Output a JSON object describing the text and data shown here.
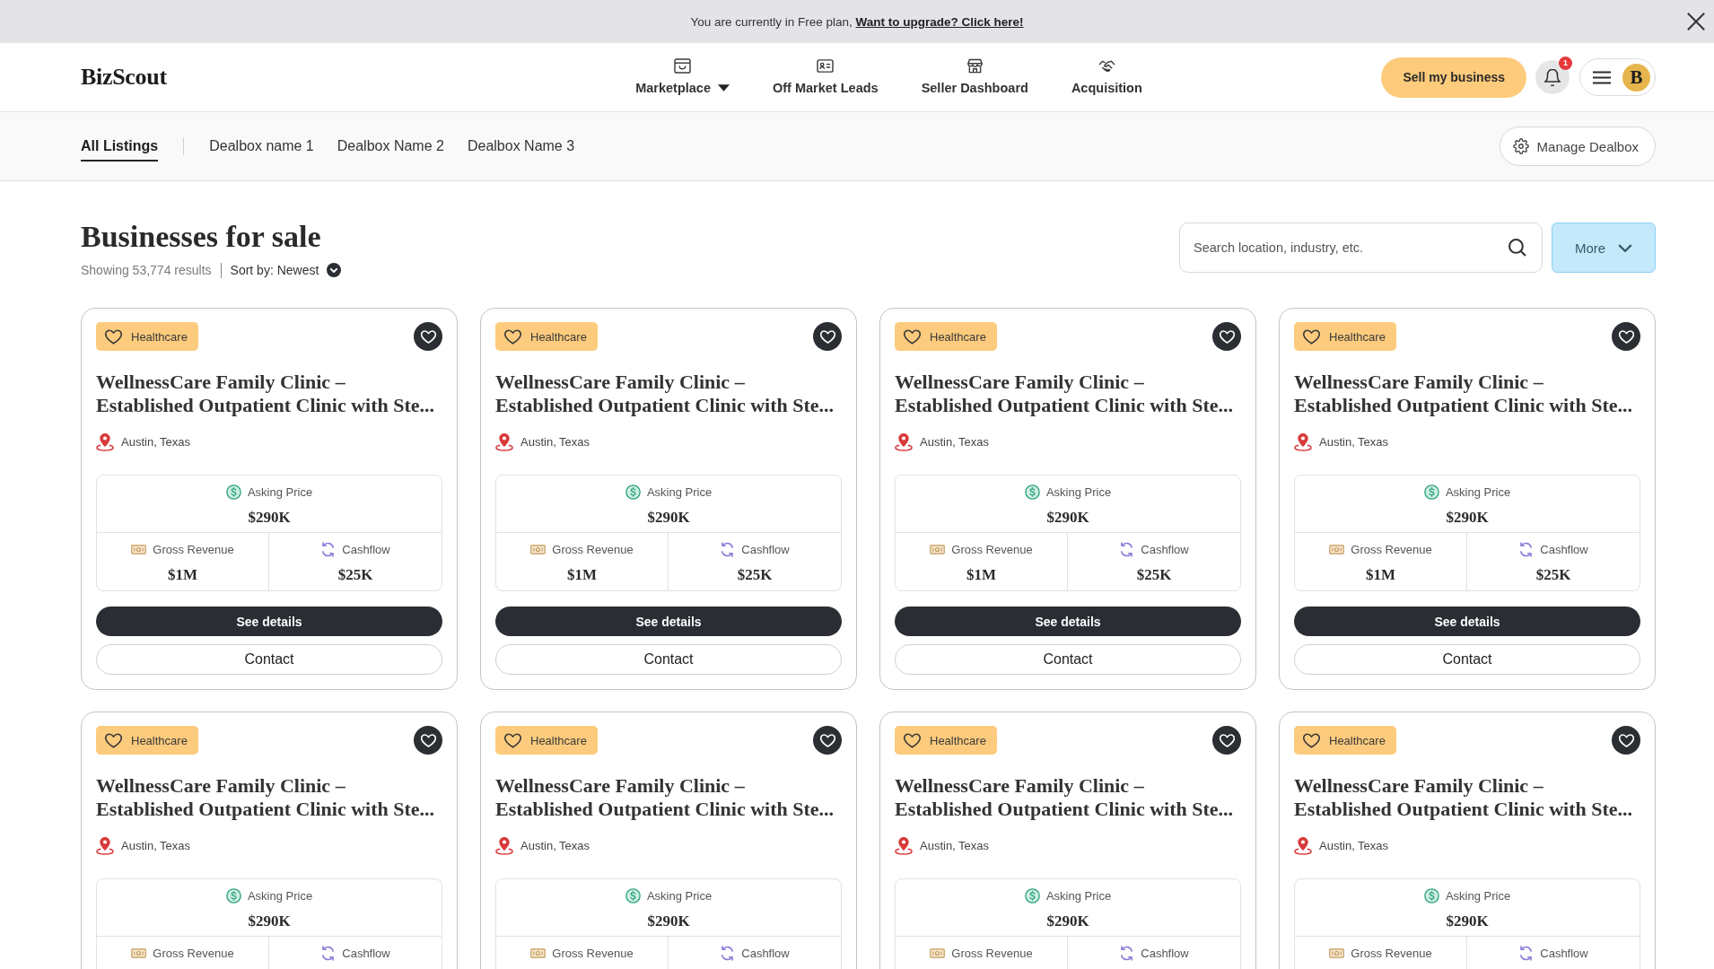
{
  "banner": {
    "text": "You are currently in Free plan,",
    "link": "Want to upgrade? Click here!"
  },
  "header": {
    "logo": "BizScout",
    "nav": [
      {
        "label": "Marketplace",
        "kind": "dropdown"
      },
      {
        "label": "Off Market Leads",
        "kind": "link"
      },
      {
        "label": "Seller Dashboard",
        "kind": "link"
      },
      {
        "label": "Acquisition",
        "kind": "link"
      }
    ],
    "sell_button": "Sell my business",
    "notifications": "1",
    "avatar": "B"
  },
  "subnav": {
    "tabs": [
      {
        "label": "All Listings",
        "selected": true
      },
      {
        "label": "Dealbox name 1",
        "selected": false
      },
      {
        "label": "Dealbox Name 2",
        "selected": false
      },
      {
        "label": "Dealbox Name 3",
        "selected": false
      }
    ],
    "manage_button": "Manage Dealbox"
  },
  "listings": {
    "title": "Businesses for sale",
    "results": "Showing 53,774 results",
    "sort": "Sort by: Newest",
    "search": {
      "placeholder": "Search location, industry, etc."
    },
    "more_button": "More",
    "cards": [
      {
        "category": "Healthcare",
        "title": "WellnessCare Family Clinic – Established Outpatient Clinic with Ste...",
        "location": "Austin, Texas",
        "stats": [
          {
            "label": "Asking Price",
            "value": "$290K"
          },
          {
            "label": "Gross Revenue",
            "value": "$1M"
          },
          {
            "label": "Cashflow",
            "value": "$25K"
          }
        ],
        "actions": [
          {
            "label": "See details",
            "kind": "primary"
          },
          {
            "label": "Contact",
            "kind": "secondary"
          }
        ]
      },
      {
        "category": "Healthcare",
        "title": "WellnessCare Family Clinic – Established Outpatient Clinic with Ste...",
        "location": "Austin, Texas",
        "stats": [
          {
            "label": "Asking Price",
            "value": "$290K"
          },
          {
            "label": "Gross Revenue",
            "value": "$1M"
          },
          {
            "label": "Cashflow",
            "value": "$25K"
          }
        ],
        "actions": [
          {
            "label": "See details",
            "kind": "primary"
          },
          {
            "label": "Contact",
            "kind": "secondary"
          }
        ]
      },
      {
        "category": "Healthcare",
        "title": "WellnessCare Family Clinic – Established Outpatient Clinic with Ste...",
        "location": "Austin, Texas",
        "stats": [
          {
            "label": "Asking Price",
            "value": "$290K"
          },
          {
            "label": "Gross Revenue",
            "value": "$1M"
          },
          {
            "label": "Cashflow",
            "value": "$25K"
          }
        ],
        "actions": [
          {
            "label": "See details",
            "kind": "primary"
          },
          {
            "label": "Contact",
            "kind": "secondary"
          }
        ]
      },
      {
        "category": "Healthcare",
        "title": "WellnessCare Family Clinic – Established Outpatient Clinic with Ste...",
        "location": "Austin, Texas",
        "stats": [
          {
            "label": "Asking Price",
            "value": "$290K"
          },
          {
            "label": "Gross Revenue",
            "value": "$1M"
          },
          {
            "label": "Cashflow",
            "value": "$25K"
          }
        ],
        "actions": [
          {
            "label": "See details",
            "kind": "primary"
          },
          {
            "label": "Contact",
            "kind": "secondary"
          }
        ]
      },
      {
        "category": "Healthcare",
        "title": "WellnessCare Family Clinic – Established Outpatient Clinic with Ste...",
        "location": "Austin, Texas",
        "stats": [
          {
            "label": "Asking Price",
            "value": "$290K"
          },
          {
            "label": "Gross Revenue"
          },
          {
            "label": "Cashflow"
          }
        ]
      },
      {
        "category": "Healthcare",
        "title": "WellnessCare Family Clinic – Established Outpatient Clinic with Ste...",
        "location": "Austin, Texas",
        "stats": [
          {
            "label": "Asking Price",
            "value": "$290K"
          },
          {
            "label": "Gross Revenue"
          },
          {
            "label": "Cashflow"
          }
        ]
      },
      {
        "category": "Healthcare",
        "title": "WellnessCare Family Clinic – Established Outpatient Clinic with Ste...",
        "location": "Austin, Texas",
        "stats": [
          {
            "label": "Asking Price",
            "value": "$290K"
          },
          {
            "label": "Gross Revenue"
          },
          {
            "label": "Cashflow"
          }
        ]
      },
      {
        "category": "Healthcare",
        "title": "WellnessCare Family Clinic – Established Outpatient Clinic with Ste...",
        "location": "Austin, Texas",
        "stats": [
          {
            "label": "Asking Price",
            "value": "$290K"
          },
          {
            "label": "Gross Revenue"
          },
          {
            "label": "Cashflow"
          }
        ]
      }
    ]
  }
}
